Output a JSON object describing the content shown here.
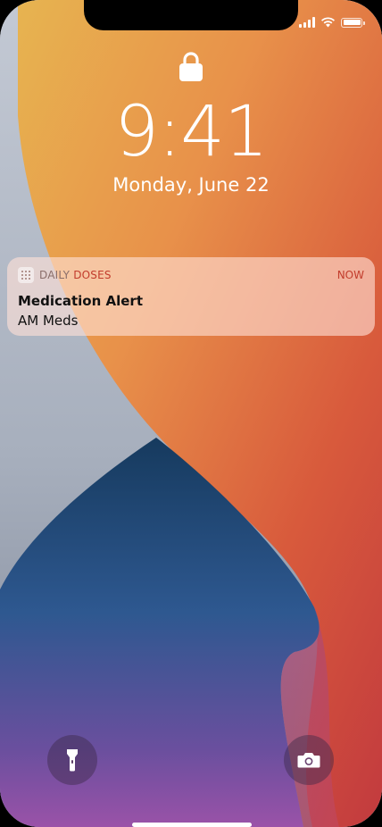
{
  "status_bar": {
    "signal_bars": 4,
    "wifi_icon": "wifi-icon",
    "battery_level": 1.0
  },
  "lock_screen": {
    "lock_icon": "lock-icon",
    "time": "9:41",
    "date": "Monday, June 22"
  },
  "notification": {
    "app_icon": "calendar-grid-icon",
    "app_name_part1": "DAILY ",
    "app_name_part2": "DOSES",
    "time": "NOW",
    "title": "Medication Alert",
    "body": "AM Meds"
  },
  "quick_actions": {
    "left_icon": "flashlight-icon",
    "right_icon": "camera-icon"
  },
  "colors": {
    "accent": "#c23c2c",
    "notification_bg": "#ffe0d6"
  }
}
